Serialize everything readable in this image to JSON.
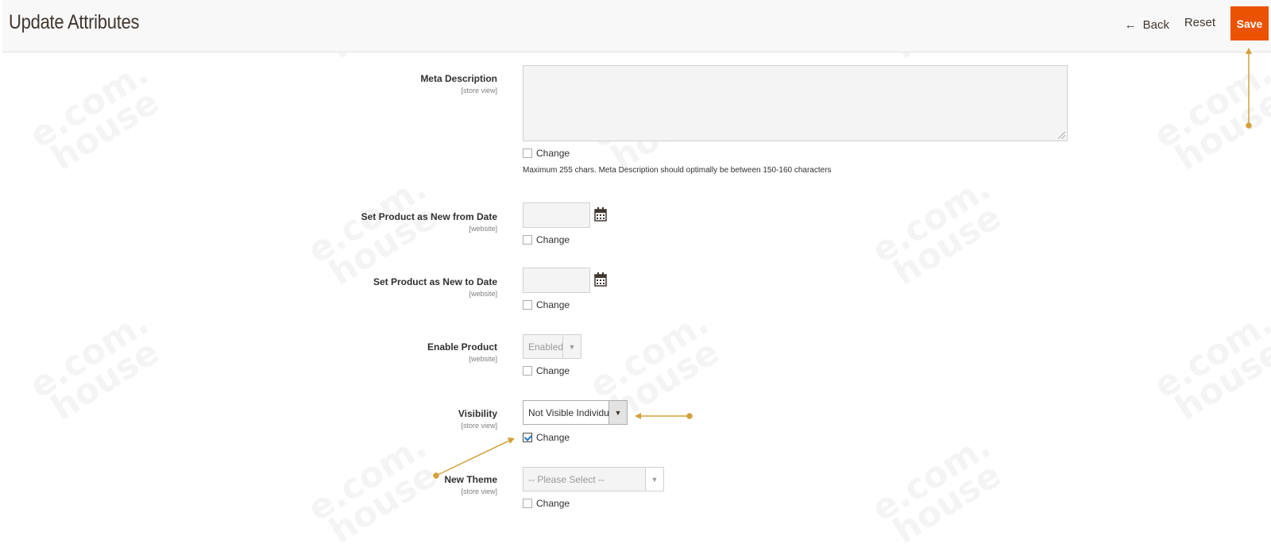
{
  "header": {
    "title": "Update Attributes",
    "back_label": "Back",
    "reset_label": "Reset",
    "save_label": "Save"
  },
  "fields": {
    "meta_description": {
      "label": "Meta Description",
      "scope": "[store view]",
      "change_label": "Change",
      "change_checked": false,
      "note": "Maximum 255 chars. Meta Description should optimally be between 150-160 characters"
    },
    "new_from_date": {
      "label": "Set Product as New from Date",
      "scope": "[website]",
      "change_label": "Change",
      "change_checked": false
    },
    "new_to_date": {
      "label": "Set Product as New to Date",
      "scope": "[website]",
      "change_label": "Change",
      "change_checked": false
    },
    "enable_product": {
      "label": "Enable Product",
      "scope": "[website]",
      "selected": "Enabled",
      "change_label": "Change",
      "change_checked": false
    },
    "visibility": {
      "label": "Visibility",
      "scope": "[store view]",
      "selected": "Not Visible Individually",
      "change_label": "Change",
      "change_checked": true
    },
    "new_theme": {
      "label": "New Theme",
      "scope": "[store view]",
      "selected": "-- Please Select --",
      "change_label": "Change",
      "change_checked": false
    }
  },
  "watermark": {
    "line1": "e.com.",
    "line2": "house"
  },
  "colors": {
    "accent": "#eb5202",
    "annotation": "#d4a03a",
    "checkmark": "#1979c3"
  }
}
